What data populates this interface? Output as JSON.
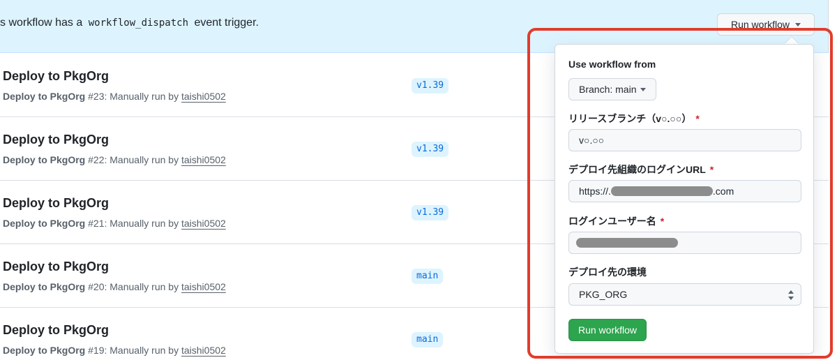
{
  "banner": {
    "text_prefix": "s workflow has a",
    "code": "workflow_dispatch",
    "text_suffix": "event trigger.",
    "run_button_label": "Run workflow"
  },
  "runs": [
    {
      "title": "Deploy to PkgOrg",
      "workflow": "Deploy to PkgOrg",
      "number": "#23",
      "meta": ": Manually run by",
      "user": "taishi0502",
      "branch": "v1.39"
    },
    {
      "title": "Deploy to PkgOrg",
      "workflow": "Deploy to PkgOrg",
      "number": "#22",
      "meta": ": Manually run by",
      "user": "taishi0502",
      "branch": "v1.39"
    },
    {
      "title": "Deploy to PkgOrg",
      "workflow": "Deploy to PkgOrg",
      "number": "#21",
      "meta": ": Manually run by",
      "user": "taishi0502",
      "branch": "v1.39"
    },
    {
      "title": "Deploy to PkgOrg",
      "workflow": "Deploy to PkgOrg",
      "number": "#20",
      "meta": ": Manually run by",
      "user": "taishi0502",
      "branch": "main"
    },
    {
      "title": "Deploy to PkgOrg",
      "workflow": "Deploy to PkgOrg",
      "number": "#19",
      "meta": ": Manually run by",
      "user": "taishi0502",
      "branch": "main"
    }
  ],
  "popover": {
    "heading": "Use workflow from",
    "branch_button": "Branch: main",
    "fields": [
      {
        "label": "リリースブランチ（v○.○○）",
        "required": "*",
        "value": "v○.○○"
      },
      {
        "label": "デプロイ先組織のログインURL",
        "required": "*",
        "value_prefix": "https://.",
        "value_suffix": ".com"
      },
      {
        "label": "ログインユーザー名",
        "required": "*",
        "value": ""
      },
      {
        "label": "デプロイ先の環境",
        "value": "PKG_ORG"
      }
    ],
    "submit_label": "Run workflow"
  },
  "colors": {
    "banner_bg": "#ddf4ff",
    "primary_green": "#2da44e",
    "highlight_red": "#e13c2c",
    "required_red": "#cf222e",
    "branch_tag_text": "#0969da"
  }
}
